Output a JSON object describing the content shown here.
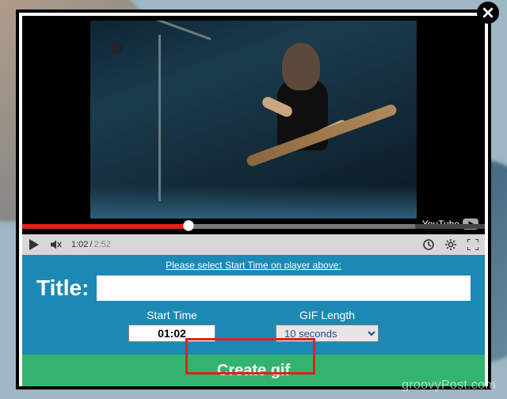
{
  "video": {
    "current_time": "1:02",
    "duration": "2:52",
    "progress_pct": 36,
    "brand_label": "YouTube"
  },
  "form": {
    "hint": "Please select Start Time on player above:",
    "title_label": "Title:",
    "title_value": "",
    "start_label": "Start Time",
    "start_value": "01:02",
    "length_label": "GIF Length",
    "length_value": "10 seconds"
  },
  "buttons": {
    "create_label": "Create gif"
  },
  "watermark": "groovyPost.com"
}
